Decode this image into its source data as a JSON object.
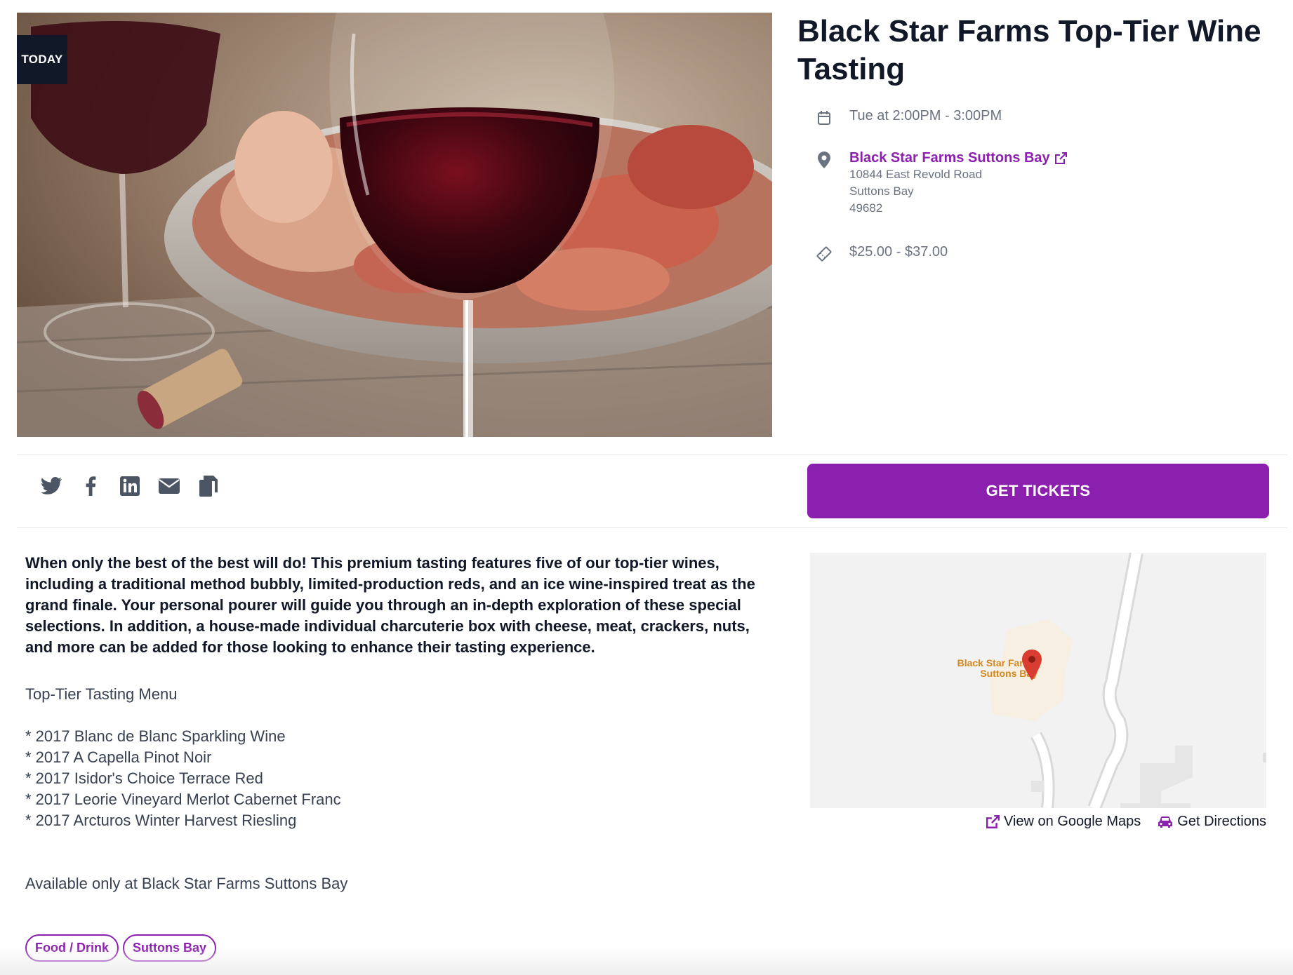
{
  "event": {
    "badge": "TODAY",
    "title": "Black Star Farms Top-Tier Wine Tasting",
    "datetime": "Tue at 2:00PM - 3:00PM",
    "venue": {
      "name": "Black Star Farms Suttons Bay",
      "address_line1": "10844 East Revold Road",
      "city": "Suttons Bay",
      "zip": "49682"
    },
    "price": "$25.00 - $37.00"
  },
  "actions": {
    "tickets_label": "GET TICKETS",
    "share_icons": [
      "twitter-icon",
      "facebook-icon",
      "linkedin-icon",
      "email-icon",
      "copy-icon"
    ]
  },
  "description": {
    "intro": "When only the best of the best will do! This premium tasting features five of our top-tier wines, including a traditional method bubbly, limited-production reds, and an ice wine-inspired treat as the grand finale. Your personal pourer will guide you through an in-depth exploration of these special selections. In addition, a house-made individual charcuterie box with cheese, meat, crackers, nuts, and more can be added for those looking to enhance their tasting experience.",
    "menu_title": "Top-Tier Tasting Menu",
    "menu_items": [
      "* 2017 Blanc de Blanc Sparkling Wine",
      "* 2017 A Capella Pinot Noir",
      "* 2017 Isidor's Choice Terrace Red",
      "* 2017 Leorie Vineyard Merlot Cabernet Franc",
      "* 2017 Arcturos Winter Harvest Riesling"
    ],
    "availability": "Available only at Black Star Farms Suttons Bay"
  },
  "tags": [
    "Food / Drink",
    "Suttons Bay"
  ],
  "map": {
    "place_label_line1": "Black Star Farms",
    "place_label_line2": "Suttons Bay",
    "view_label": "View on Google Maps",
    "directions_label": "Get Directions"
  },
  "colors": {
    "accent": "#8b1fae",
    "badge_bg": "#111827",
    "map_pin": "#d93c30",
    "map_label": "#d4871f"
  }
}
